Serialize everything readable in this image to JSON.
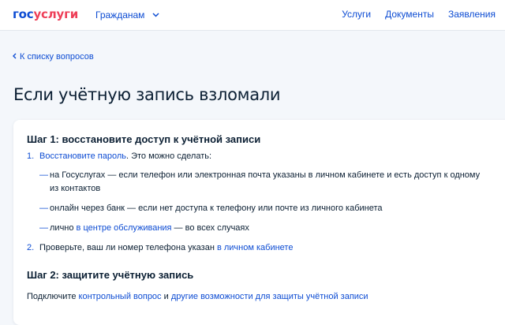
{
  "header": {
    "logo_gos": "гос",
    "logo_uslugi": "услуги",
    "citizens_label": "Гражданам",
    "links": [
      "Услуги",
      "Документы",
      "Заявления"
    ]
  },
  "back_link": "К списку вопросов",
  "page_title": "Если учётную запись взломали",
  "step1": {
    "title": "Шаг 1: восстановите доступ к учётной записи",
    "item1_num": "1.",
    "item1_link": "Восстановите пароль",
    "item1_rest": ". Это можно сделать:",
    "bullets": [
      {
        "line1": "на Госуслугах — если телефон или электронная почта указаны в личном кабинете и есть доступ к одному",
        "line2": "из контактов"
      },
      {
        "text": "онлайн через банк — если нет доступа к телефону или почте из личного кабинета"
      },
      {
        "pre": "лично ",
        "link": "в центре обслуживания",
        "post": " — во всех случаях"
      }
    ],
    "item2_num": "2.",
    "item2_text": "Проверьте, ваш ли номер телефона указан ",
    "item2_link": "в личном кабинете"
  },
  "step2": {
    "title": "Шаг 2: защитите учётную запись",
    "pre": "Подключите ",
    "link1": "контрольный вопрос",
    "mid": " и ",
    "link2": "другие возможности для защиты учётной записи"
  },
  "colors": {
    "brand_blue": "#0d4cd3",
    "brand_red": "#ee3f58",
    "text": "#0b1f33",
    "background": "#f4f7fb"
  },
  "icons": {
    "dropdown": "chevron-down-icon",
    "back": "chevron-left-icon"
  }
}
